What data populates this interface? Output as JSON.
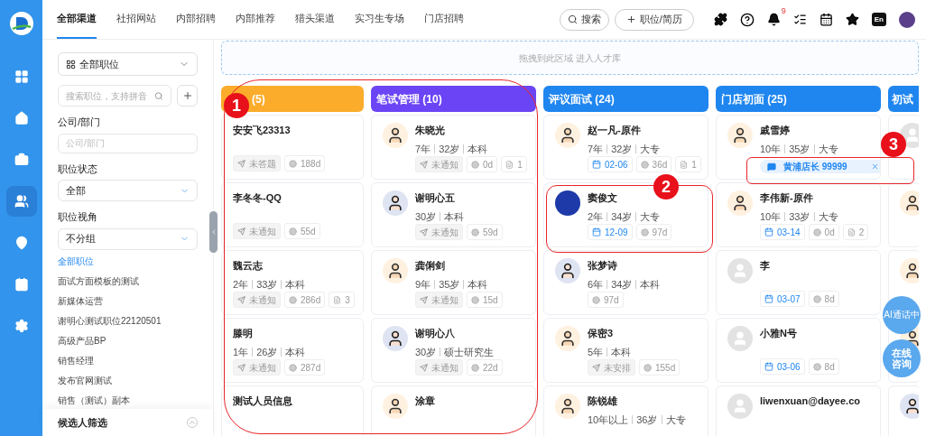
{
  "rail": {
    "items": [
      {
        "kind": "grid",
        "selected": false
      },
      {
        "kind": "home",
        "selected": false
      },
      {
        "kind": "briefcase",
        "selected": false
      },
      {
        "kind": "users",
        "selected": true
      },
      {
        "kind": "pin",
        "selected": false
      },
      {
        "kind": "contact",
        "selected": false
      },
      {
        "kind": "settings",
        "selected": false
      }
    ]
  },
  "tabs": [
    {
      "label": "全部渠道",
      "selected": true
    },
    {
      "label": "社招网站",
      "selected": false
    },
    {
      "label": "内部招聘",
      "selected": false
    },
    {
      "label": "内部推荐",
      "selected": false
    },
    {
      "label": "猎头渠道",
      "selected": false
    },
    {
      "label": "实习生专场",
      "selected": false
    },
    {
      "label": "门店招聘",
      "selected": false
    }
  ],
  "toolbar": {
    "search": "搜索",
    "add": "职位/简历",
    "bell_count": "9",
    "lang": "En"
  },
  "sidebar": {
    "position_select": "全部职位",
    "search_placeholder": "搜索职位，支持拼音",
    "company_label": "公司/部门",
    "company_placeholder": "公司/部门",
    "status_label": "职位状态",
    "status_value": "全部",
    "view_label": "职位视角",
    "view_value": "不分组",
    "jobs": [
      {
        "label": "全部职位",
        "selected": true
      },
      {
        "label": "面试方面模板的测试",
        "selected": false
      },
      {
        "label": "新媒体运营",
        "selected": false
      },
      {
        "label": "谢明心测试职位22120501",
        "selected": false
      },
      {
        "label": "高级产品BP",
        "selected": false
      },
      {
        "label": "销售经理",
        "selected": false
      },
      {
        "label": "发布官网测试",
        "selected": false
      },
      {
        "label": "销售（测试）副本",
        "selected": false
      }
    ],
    "footer": "候选人筛选"
  },
  "dropzone": "拖拽到此区域 进入人才库",
  "columns": [
    {
      "title": "(5)",
      "color": "#fbac2a",
      "cards": [
        {
          "name": "安安飞23313",
          "tags": [
            {
              "kind": "notice",
              "text": "未答题"
            },
            {
              "kind": "days",
              "text": "188d"
            }
          ]
        },
        {
          "name": "李冬冬-QQ",
          "tags": [
            {
              "kind": "notice",
              "text": "未通知"
            },
            {
              "kind": "days",
              "text": "55d"
            }
          ]
        },
        {
          "name": "魏云志",
          "info": [
            "2年",
            "33岁",
            "本科"
          ],
          "tags": [
            {
              "kind": "notice",
              "text": "未通知"
            },
            {
              "kind": "days",
              "text": "286d"
            },
            {
              "kind": "count",
              "text": "3"
            }
          ]
        },
        {
          "name": "滕明",
          "info": [
            "1年",
            "26岁",
            "本科"
          ],
          "tags": [
            {
              "kind": "notice",
              "text": "未通知"
            },
            {
              "kind": "days",
              "text": "287d"
            }
          ]
        },
        {
          "name": "测试人员信息"
        }
      ]
    },
    {
      "title": "笔试管理 (10)",
      "color": "#6b45f5",
      "cards": [
        {
          "name": "朱晓光",
          "kind": "male",
          "info": [
            "7年",
            "32岁",
            "本科"
          ],
          "tags": [
            {
              "kind": "notice",
              "text": "未通知"
            },
            {
              "kind": "days",
              "text": "0d"
            },
            {
              "kind": "count",
              "text": "1"
            }
          ]
        },
        {
          "name": "谢明心五",
          "kind": "female",
          "info": [
            "30岁",
            "本科"
          ],
          "tags": [
            {
              "kind": "notice",
              "text": "未通知"
            },
            {
              "kind": "days",
              "text": "59d"
            }
          ]
        },
        {
          "name": "龚俐剑",
          "kind": "male",
          "info": [
            "9年",
            "35岁",
            "本科"
          ],
          "tags": [
            {
              "kind": "notice",
              "text": "未通知"
            },
            {
              "kind": "days",
              "text": "15d"
            }
          ]
        },
        {
          "name": "谢明心八",
          "kind": "female",
          "info": [
            "30岁",
            "硕士研究生"
          ],
          "tags": [
            {
              "kind": "notice",
              "text": "未通知"
            },
            {
              "kind": "days",
              "text": "22d"
            }
          ]
        },
        {
          "name": "涂章",
          "kind": "male"
        }
      ]
    },
    {
      "title": "评议面试 (24)",
      "color": "#1f86f0",
      "cards": [
        {
          "name": "赵一凡-原件",
          "kind": "male",
          "info": [
            "7年",
            "32岁",
            "大专"
          ],
          "tags": [
            {
              "kind": "date",
              "text": "02-06"
            },
            {
              "kind": "days",
              "text": "36d"
            },
            {
              "kind": "count",
              "text": "1"
            }
          ]
        },
        {
          "name": "窦俊文",
          "kind": "photo",
          "info": [
            "2年",
            "34岁",
            "大专"
          ],
          "tags": [
            {
              "kind": "date",
              "text": "12-09"
            },
            {
              "kind": "days",
              "text": "97d"
            }
          ]
        },
        {
          "name": "张梦诗",
          "kind": "female",
          "info": [
            "6年",
            "34岁",
            "本科"
          ],
          "tags": [
            {
              "kind": "days",
              "text": "97d"
            }
          ]
        },
        {
          "name": "保密3",
          "kind": "male",
          "info": [
            "5年",
            "本科"
          ],
          "tags": [
            {
              "kind": "notice",
              "text": "未安排"
            },
            {
              "kind": "days",
              "text": "155d"
            }
          ]
        },
        {
          "name": "陈锐雄",
          "kind": "male",
          "info": [
            "10年以上",
            "36岁",
            "大专"
          ]
        }
      ]
    },
    {
      "title": "门店初面 (25)",
      "color": "#1f86f0",
      "cards": [
        {
          "name": "戚雪婷",
          "kind": "male",
          "info": [
            "10年",
            "35岁",
            "大专"
          ],
          "chip": "黄浦店长 99999"
        },
        {
          "name": "李伟新-原件",
          "kind": "male",
          "info": [
            "10年",
            "33岁",
            "大专"
          ],
          "tags": [
            {
              "kind": "date",
              "text": "03-14"
            },
            {
              "kind": "days",
              "text": "0d"
            },
            {
              "kind": "count",
              "text": "2"
            }
          ]
        },
        {
          "name": "李",
          "kind": "blank",
          "tags": [
            {
              "kind": "date",
              "text": "03-07"
            },
            {
              "kind": "days",
              "text": "8d"
            }
          ]
        },
        {
          "name": "小雅N号",
          "kind": "blank",
          "tags": [
            {
              "kind": "date",
              "text": "03-06"
            },
            {
              "kind": "days",
              "text": "8d"
            }
          ]
        },
        {
          "name": "liwenxuan@dayee.co",
          "kind": "blank"
        }
      ]
    },
    {
      "title": "初试",
      "color": "#1f86f0",
      "cards": [
        {
          "kind": "blank"
        },
        {
          "kind": "male"
        },
        {
          "kind": "male"
        },
        {
          "kind": "male"
        },
        {
          "kind": "female"
        }
      ]
    }
  ],
  "floating": [
    "AI通话中",
    "在线咨询"
  ],
  "annotations": [
    {
      "label": "1"
    },
    {
      "label": "2"
    },
    {
      "label": "3"
    }
  ]
}
